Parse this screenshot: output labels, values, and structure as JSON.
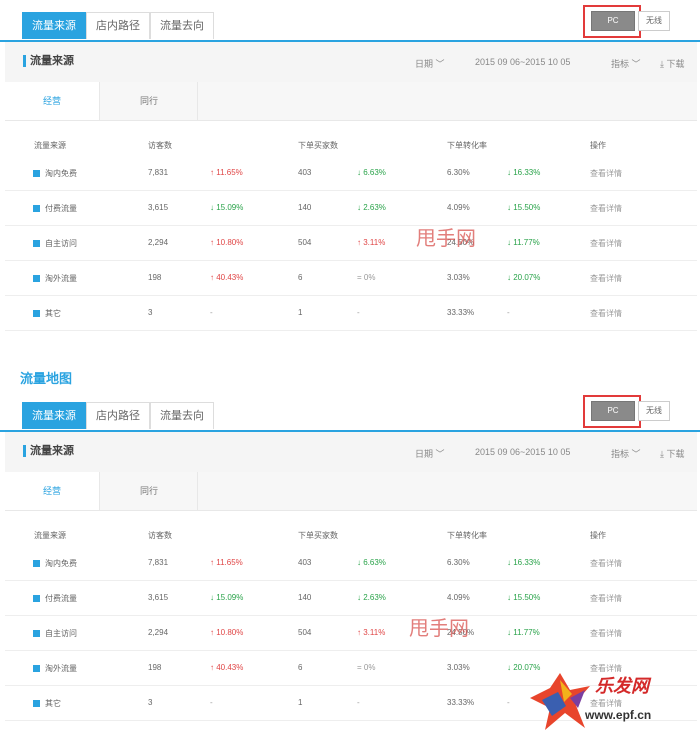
{
  "tabs": [
    "流量来源",
    "店内路径",
    "流量去向"
  ],
  "toggle": {
    "on": "PC",
    "off": "无线"
  },
  "section": {
    "title": "流量来源",
    "date_label": "日期",
    "date_range": "2015 09 06~2015 10 05",
    "metrics_label": "指标",
    "download": "下载"
  },
  "subtabs": [
    "经营",
    "同行"
  ],
  "table": {
    "headers": [
      "流量来源",
      "访客数",
      "下单买家数",
      "下单转化率",
      "操作"
    ],
    "rows": [
      {
        "source": "淘内免费",
        "visitors": "7,831",
        "visitors_change": "11.65%",
        "visitors_dir": "up",
        "buyers": "403",
        "buyers_change": "6.63%",
        "buyers_dir": "down",
        "rate": "6.30%",
        "rate_change": "16.33%",
        "rate_dir": "down",
        "op": "查看详情"
      },
      {
        "source": "付费流量",
        "visitors": "3,615",
        "visitors_change": "15.09%",
        "visitors_dir": "down",
        "buyers": "140",
        "buyers_change": "2.63%",
        "buyers_dir": "down",
        "rate": "4.09%",
        "rate_change": "15.50%",
        "rate_dir": "down",
        "op": "查看详情"
      },
      {
        "source": "自主访问",
        "visitors": "2,294",
        "visitors_change": "10.80%",
        "visitors_dir": "up",
        "buyers": "504",
        "buyers_change": "3.11%",
        "buyers_dir": "up",
        "rate": "24.50%",
        "rate_change": "11.77%",
        "rate_dir": "down",
        "op": "查看详情"
      },
      {
        "source": "淘外流量",
        "visitors": "198",
        "visitors_change": "40.43%",
        "visitors_dir": "up",
        "buyers": "6",
        "buyers_change": "0%",
        "buyers_dir": "flat",
        "rate": "3.03%",
        "rate_change": "20.07%",
        "rate_dir": "down",
        "op": "查看详情"
      },
      {
        "source": "其它",
        "visitors": "3",
        "visitors_change": "-",
        "visitors_dir": "none",
        "buyers": "1",
        "buyers_change": "-",
        "buyers_dir": "none",
        "rate": "33.33%",
        "rate_change": "-",
        "rate_dir": "none",
        "op": "查看详情"
      }
    ]
  },
  "map_title": "流量地图",
  "watermark": "甩手网",
  "logo": {
    "text": "乐发网",
    "url": "www.epf.cn"
  },
  "colors": {
    "accent": "#2aa3e0",
    "up": "#e04646",
    "down": "#2aa34a",
    "highlight": "#e23a3a"
  }
}
